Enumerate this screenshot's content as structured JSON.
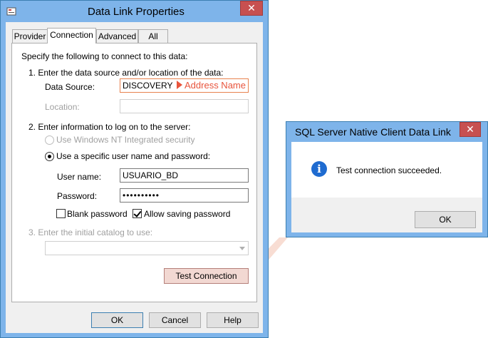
{
  "dlp_window": {
    "title": "Data Link Properties",
    "close_glyph": "✕",
    "tabs": [
      {
        "label": "Provider"
      },
      {
        "label": "Connection"
      },
      {
        "label": "Advanced"
      },
      {
        "label": "All"
      }
    ],
    "active_tab": "Connection",
    "intro": "Specify the following to connect to this data:",
    "step1": "1. Enter the data source and/or location of the data:",
    "data_source_label": "Data Source:",
    "data_source_value": "DISCOVERY",
    "data_source_annotation": "Address Name",
    "location_label": "Location:",
    "location_value": "",
    "step2": "2. Enter information to log on to the server:",
    "radio_nt_label": "Use Windows NT Integrated security",
    "radio_specific_label": "Use a specific user name and password:",
    "username_label": "User name:",
    "username_value": "USUARIO_BD",
    "password_label": "Password:",
    "password_value": "••••••••••",
    "blank_password_label": "Blank password",
    "allow_saving_label": "Allow saving password",
    "step3": "3. Enter the initial catalog to use:",
    "catalog_value": "",
    "test_connection_label": "Test Connection",
    "ok_label": "OK",
    "cancel_label": "Cancel",
    "help_label": "Help"
  },
  "sql_dialog": {
    "title": "SQL Server Native Client Data Link",
    "close_glyph": "✕",
    "icon": "i",
    "message": "Test connection succeeded.",
    "ok_label": "OK"
  },
  "colors": {
    "window_frame": "#7eb4ea",
    "close_button": "#c75050",
    "highlight": "#e8834f",
    "annotation": "#e8543c",
    "info_icon": "#1f6bd0"
  }
}
